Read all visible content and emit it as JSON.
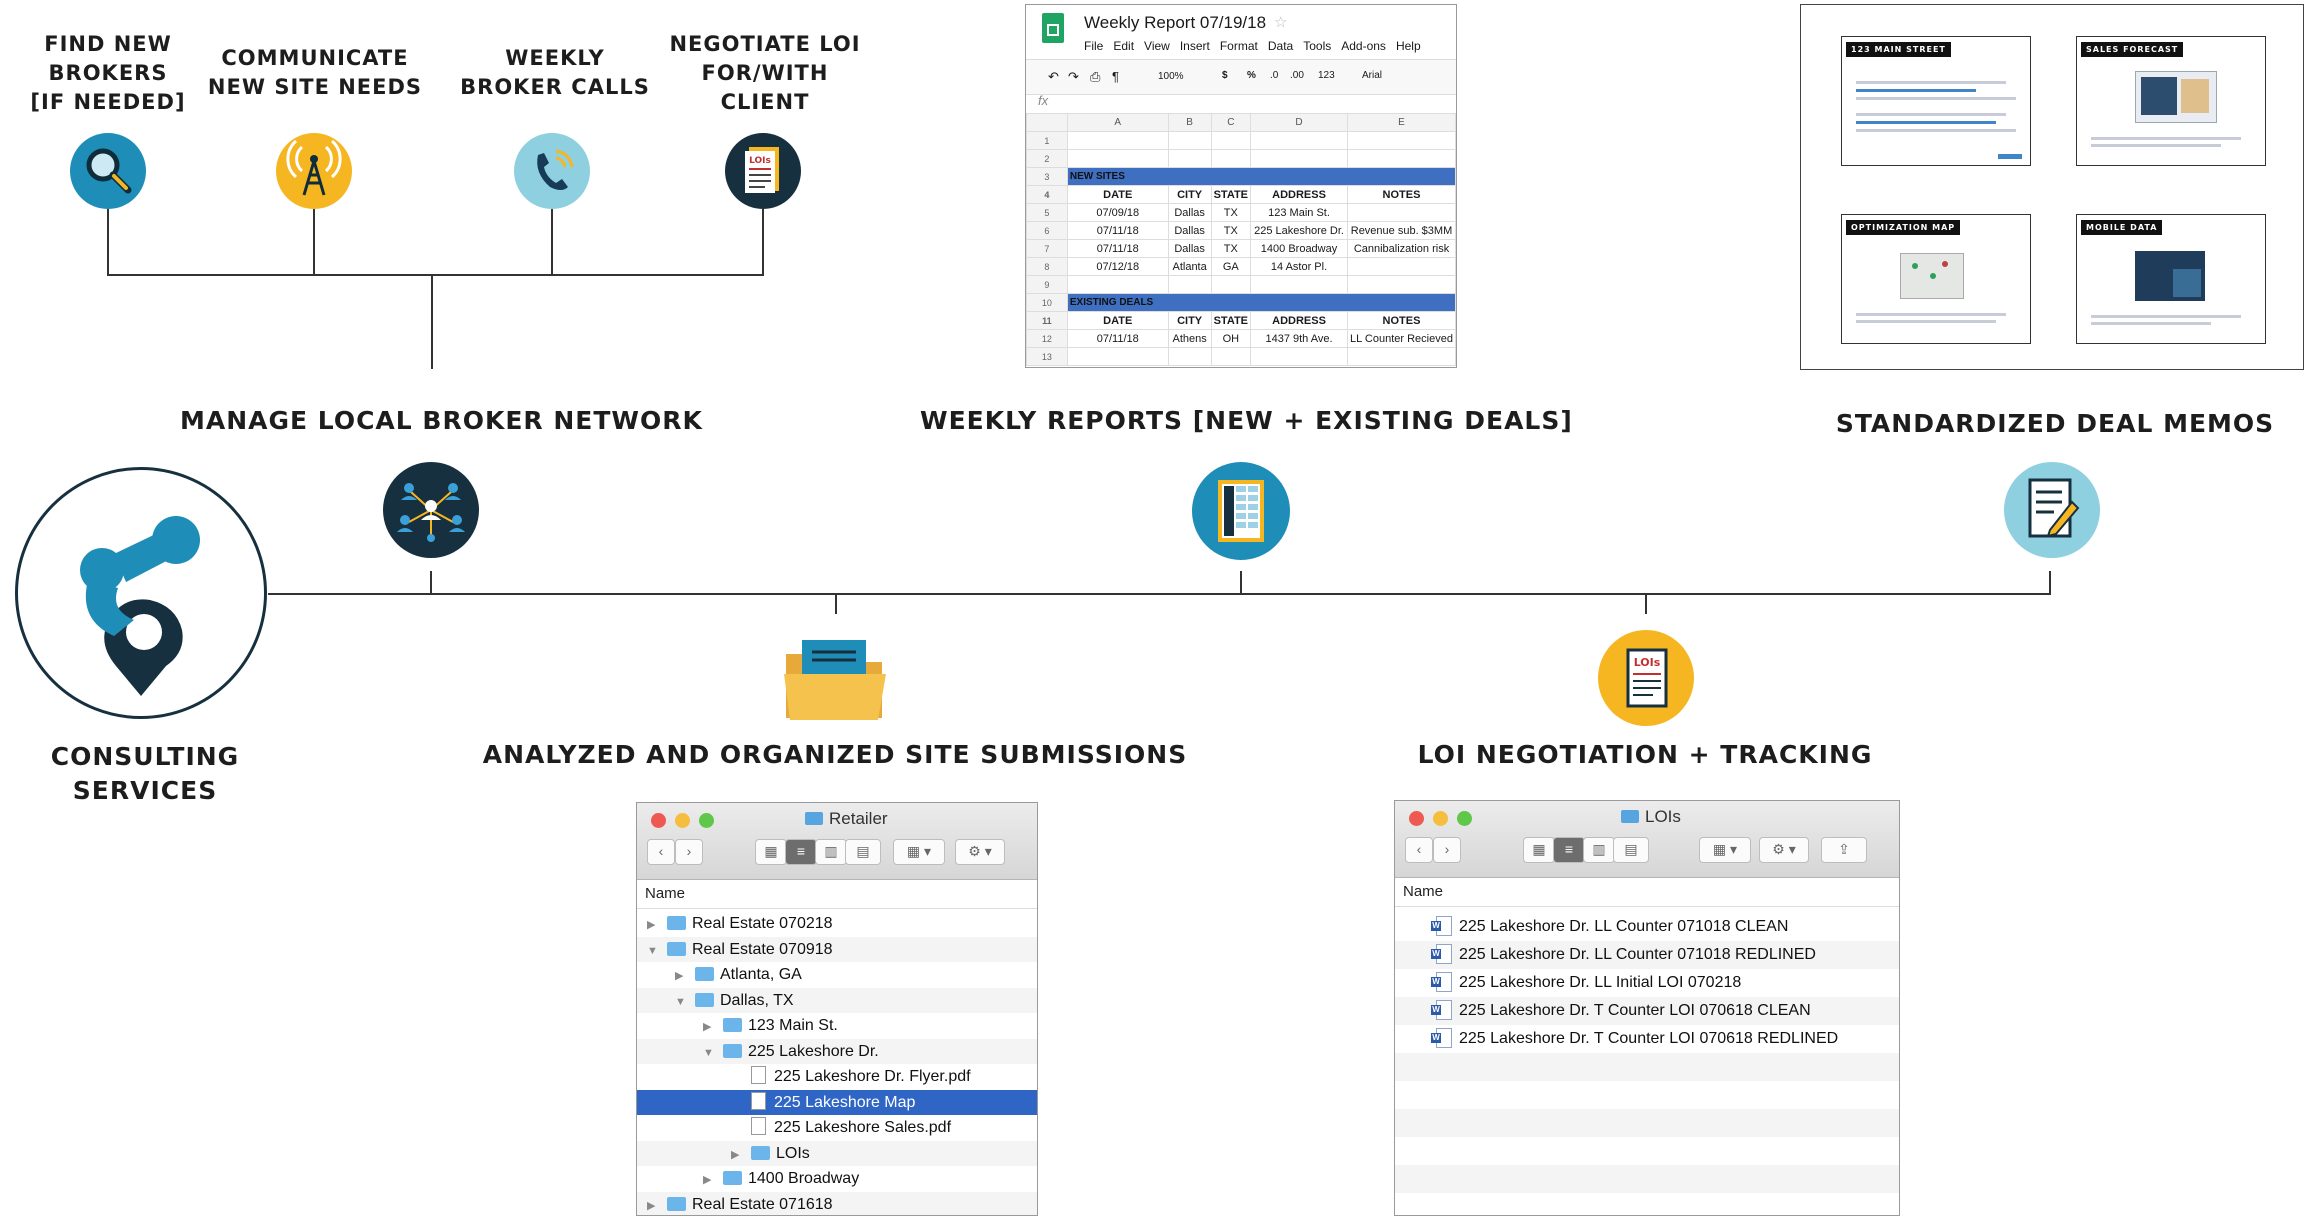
{
  "top_tasks": [
    {
      "label": "FIND NEW\nBROKERS\n[IF NEEDED]",
      "icon": "magnifier-icon"
    },
    {
      "label": "COMMUNICATE\nNEW SITE NEEDS",
      "icon": "antenna-tower-icon"
    },
    {
      "label": "WEEKLY\nBROKER CALLS",
      "icon": "phone-icon"
    },
    {
      "label": "NEGOTIATE LOI\nFOR/WITH\nCLIENT",
      "icon": "loi-document-icon"
    }
  ],
  "services": {
    "root": "CONSULTING\nSERVICES",
    "manage_broker_network": "MANAGE LOCAL BROKER NETWORK",
    "weekly_reports": "WEEKLY REPORTS [NEW + EXISTING DEALS]",
    "deal_memos": "STANDARDIZED DEAL MEMOS",
    "site_submissions": "ANALYZED AND ORGANIZED SITE SUBMISSIONS",
    "loi_tracking": "LOI NEGOTIATION + TRACKING"
  },
  "icon_text": {
    "lois": "LOIs"
  },
  "spreadsheet": {
    "title": "Weekly Report 07/19/18",
    "menu": [
      "File",
      "Edit",
      "View",
      "Insert",
      "Format",
      "Data",
      "Tools",
      "Add-ons",
      "Help"
    ],
    "toolbar": {
      "zoom": "100%",
      "currency": "$",
      "percent": "%",
      "dec0": ".0",
      "dec00": ".00",
      "fmt": "123",
      "font": "Arial"
    },
    "fx": "fx",
    "columns": [
      "A",
      "B",
      "C",
      "D",
      "E"
    ],
    "new_sites_label": "NEW SITES",
    "existing_deals_label": "EXISTING DEALS",
    "headers": [
      "DATE",
      "CITY",
      "STATE",
      "ADDRESS",
      "NOTES"
    ],
    "new_sites": [
      [
        "07/09/18",
        "Dallas",
        "TX",
        "123 Main St.",
        ""
      ],
      [
        "07/11/18",
        "Dallas",
        "TX",
        "225 Lakeshore Dr.",
        "Revenue sub. $3MM"
      ],
      [
        "07/11/18",
        "Dallas",
        "TX",
        "1400 Broadway",
        "Cannibalization risk"
      ],
      [
        "07/12/18",
        "Atlanta",
        "GA",
        "14 Astor Pl.",
        ""
      ]
    ],
    "existing_deals": [
      [
        "07/11/18",
        "Athens",
        "OH",
        "1437 9th Ave.",
        "LL Counter Recieved"
      ]
    ]
  },
  "memos": [
    {
      "tag": "123 MAIN STREET"
    },
    {
      "tag": "SALES FORECAST"
    },
    {
      "tag": "OPTIMIZATION MAP"
    },
    {
      "tag": "MOBILE DATA"
    }
  ],
  "finder_retailer": {
    "title": "Retailer",
    "column": "Name",
    "rows": [
      {
        "name": "Real Estate 070218",
        "indent": 0,
        "tri": "▶",
        "kind": "folder"
      },
      {
        "name": "Real Estate 070918",
        "indent": 0,
        "tri": "▼",
        "kind": "folder"
      },
      {
        "name": "Atlanta, GA",
        "indent": 1,
        "tri": "▶",
        "kind": "folder"
      },
      {
        "name": "Dallas, TX",
        "indent": 1,
        "tri": "▼",
        "kind": "folder"
      },
      {
        "name": "123 Main St.",
        "indent": 2,
        "tri": "▶",
        "kind": "folder"
      },
      {
        "name": "225 Lakeshore Dr.",
        "indent": 2,
        "tri": "▼",
        "kind": "folder"
      },
      {
        "name": "225 Lakeshore Dr. Flyer.pdf",
        "indent": 3,
        "tri": "",
        "kind": "doc"
      },
      {
        "name": "225 Lakeshore Map",
        "indent": 3,
        "tri": "",
        "kind": "doc",
        "selected": true
      },
      {
        "name": "225 Lakeshore Sales.pdf",
        "indent": 3,
        "tri": "",
        "kind": "doc"
      },
      {
        "name": "LOIs",
        "indent": 3,
        "tri": "▶",
        "kind": "folder"
      },
      {
        "name": "1400 Broadway",
        "indent": 2,
        "tri": "▶",
        "kind": "folder"
      },
      {
        "name": "Real Estate 071618",
        "indent": 0,
        "tri": "▶",
        "kind": "folder"
      }
    ]
  },
  "finder_lois": {
    "title": "LOIs",
    "column": "Name",
    "rows": [
      "225 Lakeshore Dr. LL Counter 071018 CLEAN",
      "225 Lakeshore Dr. LL Counter 071018 REDLINED",
      "225 Lakeshore Dr. LL Initial LOI 070218",
      "225 Lakeshore Dr. T Counter LOI 070618 CLEAN",
      "225 Lakeshore Dr. T Counter LOI 070618 REDLINED"
    ]
  },
  "colors": {
    "teal": "#1e8db8",
    "navy": "#17303f",
    "yellow": "#f6b622",
    "light_teal": "#8ed0e0",
    "sheet_band": "#3f6fc0",
    "selection": "#2f66c5"
  }
}
